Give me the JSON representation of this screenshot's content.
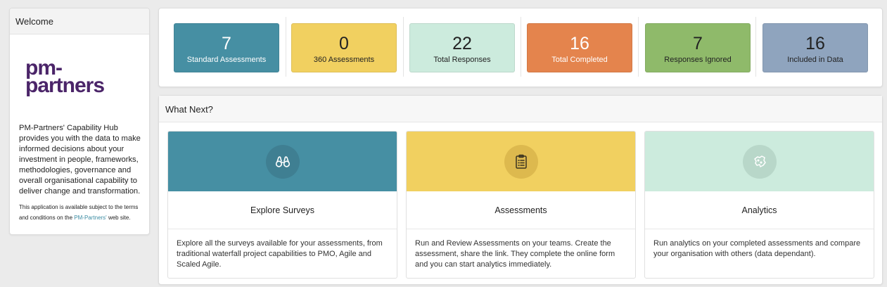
{
  "welcome": {
    "title": "Welcome",
    "logo_line1": "pm-",
    "logo_line2": "partners",
    "description": "PM-Partners' Capability Hub provides you with the data to make informed decisions about your investment in people, frameworks, methodologies, governance and overall organisational capability to deliver change and transformation.",
    "terms_prefix": "This application is available subject to the terms and conditions on the ",
    "terms_link": "PM-Partners'",
    "terms_suffix": " web site."
  },
  "stats": [
    {
      "value": "7",
      "label": "Standard Assessments",
      "bg": "#468fa3",
      "fg": "#ffffff"
    },
    {
      "value": "0",
      "label": "360 Assessments",
      "bg": "#f1d060",
      "fg": "#222222"
    },
    {
      "value": "22",
      "label": "Total Responses",
      "bg": "#ccebdd",
      "fg": "#222222"
    },
    {
      "value": "16",
      "label": "Total Completed",
      "bg": "#e4844d",
      "fg": "#ffffff"
    },
    {
      "value": "7",
      "label": "Responses Ignored",
      "bg": "#8fba6a",
      "fg": "#222222"
    },
    {
      "value": "16",
      "label": "Included in Data",
      "bg": "#8fa4be",
      "fg": "#222222"
    }
  ],
  "next": {
    "title": "What Next?",
    "cards": [
      {
        "title": "Explore Surveys",
        "icon": "binoculars-icon",
        "bg": "#468fa3",
        "circle": "#3f7f92",
        "body": "Explore all the surveys available for your assessments, from traditional waterfall project capabilities to PMO, Agile and Scaled Agile."
      },
      {
        "title": "Assessments",
        "icon": "clipboard-icon",
        "bg": "#f1d060",
        "circle": "#ddb94e",
        "body": "Run and Review Assessments on your teams. Create the assessment, share the link. They complete the online form and you can start analytics immediately."
      },
      {
        "title": "Analytics",
        "icon": "map-icon",
        "bg": "#ccebdd",
        "circle": "#b8d7c9",
        "body": "Run analytics on your completed assessments and compare your organisation with others (data dependant)."
      }
    ]
  }
}
